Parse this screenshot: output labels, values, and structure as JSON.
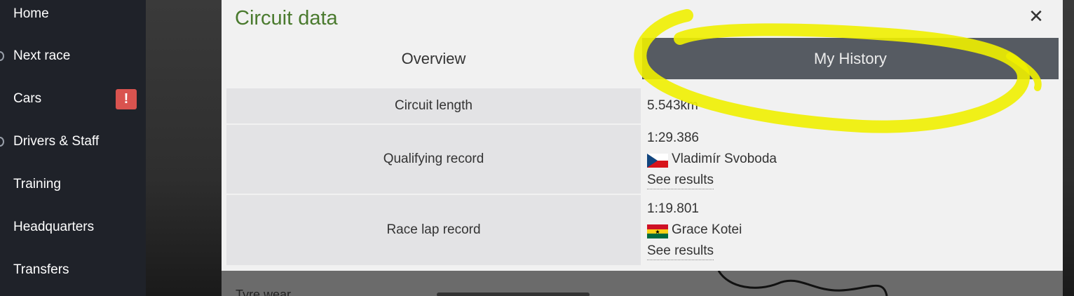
{
  "sidebar": {
    "items": [
      {
        "label": "Home"
      },
      {
        "label": "Next race"
      },
      {
        "label": "Cars",
        "badge": "!"
      },
      {
        "label": "Drivers & Staff"
      },
      {
        "label": "Training"
      },
      {
        "label": "Headquarters"
      },
      {
        "label": "Transfers"
      }
    ]
  },
  "modal": {
    "title": "Circuit data",
    "close": "✕",
    "tabs": [
      {
        "label": "Overview",
        "active": false
      },
      {
        "label": "My History",
        "active": true
      }
    ],
    "rows": {
      "length": {
        "label": "Circuit length",
        "value": "5.543km"
      },
      "qualifying": {
        "label": "Qualifying record",
        "time": "1:29.386",
        "driver": "Vladimír Svoboda",
        "flag": "czech-flag",
        "link": "See results"
      },
      "race": {
        "label": "Race lap record",
        "time": "1:19.801",
        "driver": "Grace Kotei",
        "flag": "ghana-flag",
        "link": "See results"
      }
    }
  },
  "underlay": {
    "label": "Tyre wear"
  },
  "colors": {
    "title_green": "#4a7a2e",
    "active_tab": "#565b62",
    "highlight": "#f0f000",
    "alert": "#d9534f"
  }
}
